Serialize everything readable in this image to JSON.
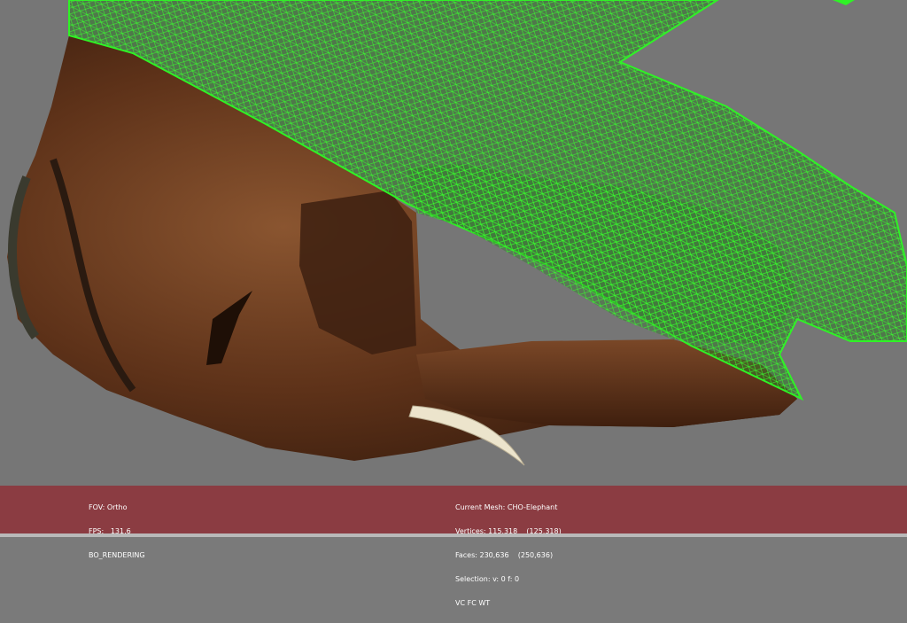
{
  "viewport": {
    "background_color": "#767676",
    "mesh_wireframe_color": "#22e51c",
    "mesh_texture_color": "#6b3a1f",
    "tusk_color": "#e9e2cc"
  },
  "status": {
    "background_color": "#8b3c42",
    "left": {
      "fov": "FOV: Ortho",
      "fps": "FPS:   131.6",
      "mode": "BO_RENDERING"
    },
    "right": {
      "current_mesh": "Current Mesh: CHO-Elephant",
      "vertices": "Vertices: 115,318    (125,318)",
      "faces": "Faces: 230,636    (250,636)",
      "selection": "Selection: v: 0 f: 0",
      "flags": "VC FC WT"
    }
  }
}
